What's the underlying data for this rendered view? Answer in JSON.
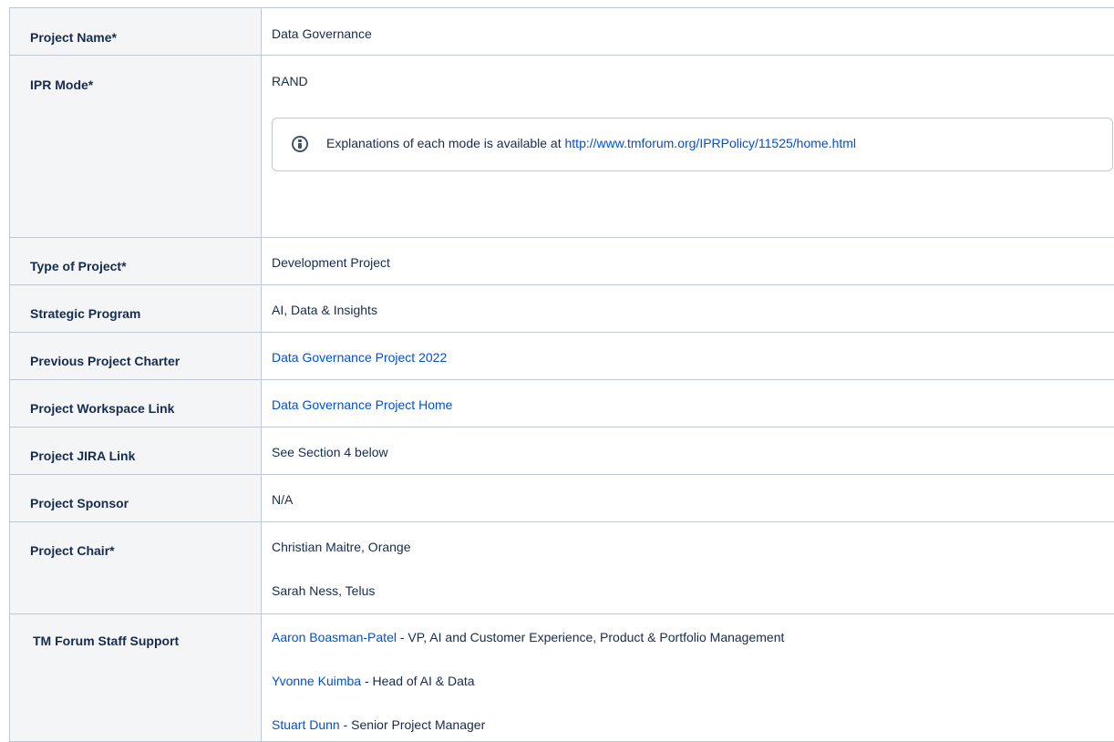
{
  "rows": {
    "project_name": {
      "label": "Project Name*",
      "value": "Data Governance"
    },
    "ipr_mode": {
      "label": "IPR Mode*",
      "value": "RAND",
      "info": {
        "text": "Explanations of each mode is available at",
        "link": "http://www.tmforum.org/IPRPolicy/11525/home.html"
      }
    },
    "type_of_project": {
      "label": "Type of Project*",
      "value": "Development Project"
    },
    "strategic_program": {
      "label": "Strategic Program",
      "value": "AI, Data & Insights"
    },
    "previous_charter": {
      "label": "Previous Project Charter",
      "link": "Data Governance Project 2022"
    },
    "workspace_link": {
      "label": "Project Workspace Link",
      "link": "Data Governance Project Home"
    },
    "jira_link": {
      "label": "Project JIRA Link",
      "value": "See Section 4 below"
    },
    "sponsor": {
      "label": "Project Sponsor",
      "value": "N/A"
    },
    "chair": {
      "label": "Project Chair*",
      "values": [
        "Christian Maitre, Orange",
        "Sarah Ness, Telus"
      ]
    },
    "staff_support": {
      "label": "TM Forum Staff Support",
      "people": [
        {
          "name": "Aaron Boasman-Patel",
          "role": " - VP, AI and Customer Experience, Product & Portfolio Management"
        },
        {
          "name": "Yvonne Kuimba",
          "role": " - Head of AI & Data"
        },
        {
          "name": "Stuart Dunn",
          "role": " - Senior Project Manager"
        }
      ]
    }
  },
  "colors": {
    "link": "#0052cc",
    "text": "#172b4d",
    "label_bg": "#f4f5f7",
    "border": "#c1c7d0"
  },
  "icons": [
    "info-icon"
  ]
}
